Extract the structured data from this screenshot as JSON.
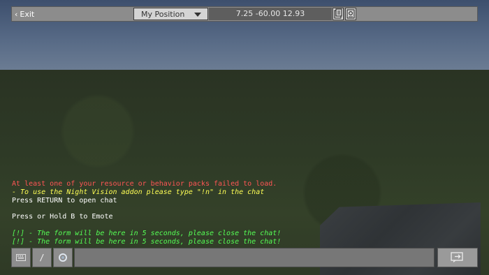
{
  "topbar": {
    "exit_label": "Exit",
    "dropdown_value": "My Position",
    "coordinates": "7.25 -60.00 12.93",
    "icons": [
      "copy-coordinates-icon",
      "screenshot-icon"
    ]
  },
  "chat": {
    "lines": [
      {
        "text": "At least one of your resource or behavior packs failed to load.",
        "color": "#ff5555"
      },
      {
        "text": "- To use the Night Vision addon please type \"!n\" in the chat",
        "color": "#ffff55"
      },
      {
        "text": "Press RETURN to open chat",
        "color": "#ffffff"
      },
      {
        "text": "",
        "color": "#ffffff"
      },
      {
        "text": "Press or Hold B to Emote",
        "color": "#ffffff"
      },
      {
        "text": "",
        "color": "#ffffff"
      },
      {
        "text": "[!] - The form will be here in 5 seconds, please close the chat!",
        "color": "#55ff55"
      },
      {
        "text": "[!] - The form will be here in 5 seconds, please close the chat!",
        "color": "#55ff55"
      }
    ]
  },
  "bottombar": {
    "buttons": [
      "keyboard-icon",
      "slash-command-icon",
      "settings-gear-icon"
    ],
    "chat_input_value": "",
    "send_icon": "send-icon"
  }
}
